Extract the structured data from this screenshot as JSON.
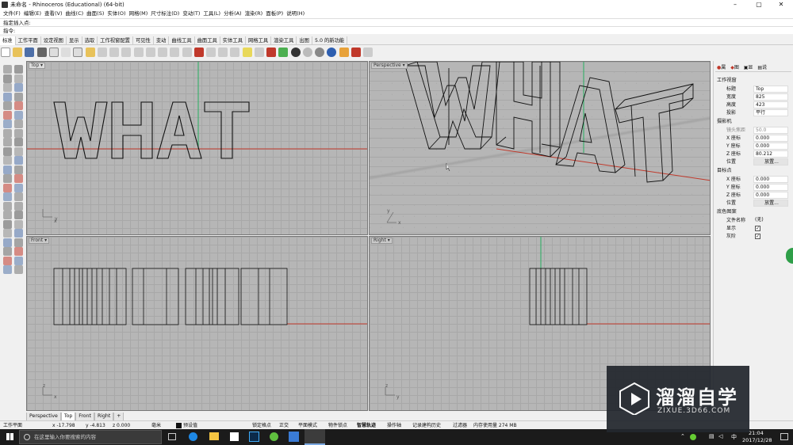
{
  "window": {
    "title": "未命名 - Rhinoceros (Educational) (64-bit)"
  },
  "menu": [
    "文件(F)",
    "编辑(E)",
    "查看(V)",
    "曲线(C)",
    "曲面(S)",
    "实体(O)",
    "网格(M)",
    "尺寸标注(D)",
    "变动(T)",
    "工具(L)",
    "分析(A)",
    "渲染(R)",
    "面板(P)",
    "说明(H)"
  ],
  "command": {
    "history": "指定插入点:",
    "prompt": "指令:"
  },
  "tabs": [
    "标准",
    "工作平面",
    "设定视图",
    "显示",
    "选取",
    "工作视窗配置",
    "可见性",
    "变动",
    "曲线工具",
    "曲面工具",
    "实体工具",
    "网格工具",
    "渲染工具",
    "出图",
    "5.0 的新功能"
  ],
  "viewports": {
    "top": "Top",
    "perspective": "Perspective",
    "front": "Front",
    "right": "Right",
    "model_text": "WHAT"
  },
  "panel": {
    "tabs": [
      "属",
      "图",
      "显",
      "说"
    ],
    "section_viewport": "工作视窗",
    "title_k": "标题",
    "title_v": "Top",
    "width_k": "宽度",
    "width_v": "825",
    "height_k": "高度",
    "height_v": "423",
    "proj_k": "投影",
    "proj_v": "平行",
    "section_camera": "摄影机",
    "lens_k": "镜头焦距",
    "lens_v": "50.0",
    "cx_k": "X 座标",
    "cx_v": "0.000",
    "cy_k": "Y 座标",
    "cy_v": "0.000",
    "cz_k": "Z 座标",
    "cz_v": "80.212",
    "cpos_k": "位置",
    "cpos_v": "放置...",
    "section_target": "目标点",
    "tx_k": "X 座标",
    "tx_v": "0.000",
    "ty_k": "Y 座标",
    "ty_v": "0.000",
    "tz_k": "Z 座标",
    "tz_v": "0.000",
    "tpos_k": "位置",
    "tpos_v": "放置...",
    "section_bg": "底色图案",
    "file_k": "文件名称",
    "file_v": "(无)",
    "show_k": "显示",
    "gray_k": "灰阶"
  },
  "bottom_tabs": [
    "Perspective",
    "Top",
    "Front",
    "Right"
  ],
  "status": {
    "plane": "工作平面",
    "x": "x -17.798",
    "y": "y -4.813",
    "z": "z 0.000",
    "unit": "毫米",
    "layer": "预设值",
    "items": [
      "锁定格点",
      "正交",
      "平面模式",
      "物件锁点",
      "智慧轨迹",
      "操作轴",
      "记录建构历史",
      "过滤器",
      "内存使用量 274 MB"
    ]
  },
  "taskbar": {
    "search": "在这里输入你要搜索的内容",
    "time": "21:04",
    "date": "2017/12/28"
  },
  "watermark": {
    "brand": "溜溜自学",
    "url": "ZIXUE.3D66.COM"
  },
  "colors": {
    "viewport_bg": "#b6b6b6",
    "x_axis": "#c0392b",
    "y_axis": "#27ae60"
  }
}
